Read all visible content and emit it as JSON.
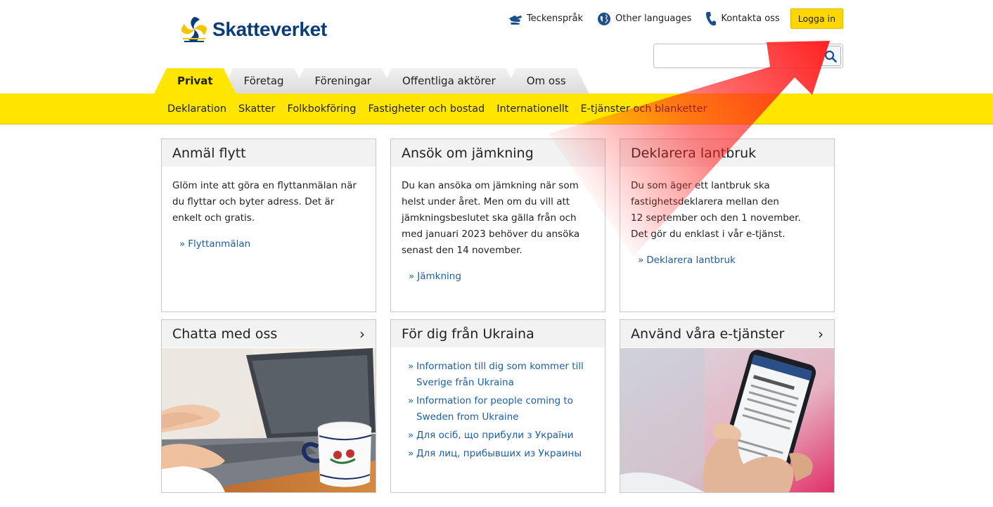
{
  "site": {
    "logo_text": "Skatteverket"
  },
  "utility": {
    "sign_language": "Teckenspråk",
    "other_languages": "Other languages",
    "contact": "Kontakta oss",
    "login": "Logga in"
  },
  "search": {
    "value": "",
    "placeholder": ""
  },
  "tabs": [
    {
      "label": "Privat",
      "active": true
    },
    {
      "label": "Företag"
    },
    {
      "label": "Föreningar"
    },
    {
      "label": "Offentliga aktörer"
    },
    {
      "label": "Om oss"
    }
  ],
  "subnav": [
    "Deklaration",
    "Skatter",
    "Folkbokföring",
    "Fastigheter och bostad",
    "Internationellt",
    "E-tjänster och blanketter"
  ],
  "cards": {
    "move": {
      "title": "Anmäl flytt",
      "text": "Glöm inte att göra en flyttanmälan när du flyttar och byter adress. Det är enkelt och gratis.",
      "link": "Flyttanmälan"
    },
    "adjust": {
      "title": "Ansök om jämkning",
      "text": "Du kan ansöka om jämkning när som helst under året. Men om du vill att jämkningsbeslutet ska gälla från och med januari 2023 behöver du ansöka senast den 14 november.",
      "link": "Jämkning"
    },
    "farm": {
      "title": "Deklarera lantbruk",
      "text_line1": "Du som äger ett lantbruk ska fastighetsdeklarera mellan den",
      "text_line2": "12 september och den 1 november.",
      "text_line3": "Det gör du enklast i vår e-tjänst.",
      "link": "Deklarera lantbruk"
    },
    "chat": {
      "title": "Chatta med oss"
    },
    "ukraine": {
      "title": "För dig från Ukraina",
      "links": [
        "Information till dig som kommer till Sverige från Ukraina",
        "Information for people coming to Sweden from Ukraine",
        "Для осіб, що прибули з України",
        "Для лиц, прибывших из Украины"
      ]
    },
    "eservices": {
      "title": "Använd våra e-tjänster"
    }
  },
  "colors": {
    "brand_yellow": "#ffe600",
    "brand_blue": "#0b3c7a",
    "link_blue": "#1a5ea8",
    "arrow_red": "#ff2020"
  }
}
